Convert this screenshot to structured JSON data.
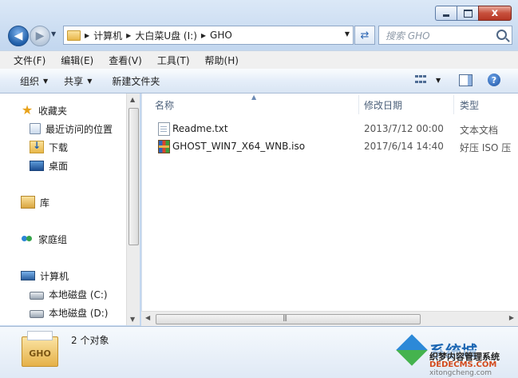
{
  "window": {
    "caption": {
      "minimize": "",
      "maximize": "",
      "close": "x"
    }
  },
  "address": {
    "crumbs": [
      "计算机",
      "大白菜U盘 (I:)",
      "GHO"
    ]
  },
  "search": {
    "placeholder": "搜索 GHO"
  },
  "menubar": {
    "items": [
      "文件(F)",
      "编辑(E)",
      "查看(V)",
      "工具(T)",
      "帮助(H)"
    ]
  },
  "commandbar": {
    "organize": "组织",
    "share": "共享",
    "new_folder": "新建文件夹",
    "help": "?"
  },
  "navigation": {
    "favorites": {
      "label": "收藏夹",
      "items": [
        "最近访问的位置",
        "下载",
        "桌面"
      ]
    },
    "libraries": "库",
    "homegroup": "家庭组",
    "computer": {
      "label": "计算机",
      "items": [
        "本地磁盘 (C:)",
        "本地磁盘 (D:)"
      ]
    }
  },
  "filelist": {
    "columns": [
      "名称",
      "修改日期",
      "类型"
    ],
    "files": [
      {
        "name": "Readme.txt",
        "date": "2013/7/12 00:00",
        "type": "文本文档",
        "icon": "text-file-icon"
      },
      {
        "name": "GHOST_WIN7_X64_WNB.iso",
        "date": "2017/6/14 14:40",
        "type": "好压 ISO 压",
        "icon": "iso-archive-icon"
      }
    ]
  },
  "details": {
    "folder_label": "GHO",
    "count": "2 个对象"
  },
  "watermark": {
    "title": "系统城",
    "line1": "织梦内容管理系统",
    "line2": "DEDECMS.COM",
    "line3": "xitongcheng.com"
  }
}
